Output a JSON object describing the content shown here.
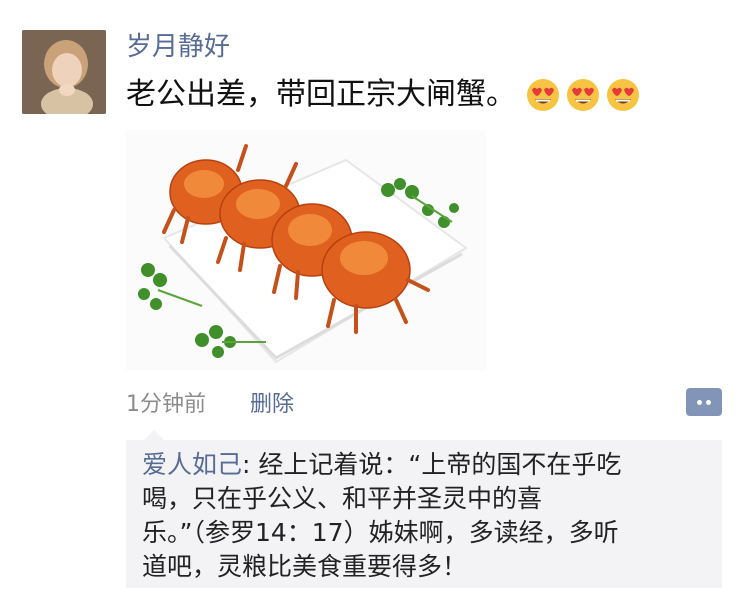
{
  "post": {
    "username": "岁月静好",
    "text": "老公出差，带回正宗大闸蟹。",
    "emojis": [
      "heart-eyes-emoji",
      "heart-eyes-emoji",
      "heart-eyes-emoji"
    ],
    "time": "1分钟前",
    "delete_label": "删除"
  },
  "comments": [
    {
      "commenter": "爱人如己",
      "separator": ": ",
      "line1": "经上记着说：“上帝的国不在乎吃",
      "line2": "喝，只在乎公义、和平并圣灵中的喜",
      "line3": "乐。”（参罗14：17）姊妹啊，多读经，多听",
      "line4": "道吧，灵粮比美食重要得多！"
    }
  ],
  "colors": {
    "link": "#576b95",
    "text": "#111111",
    "meta": "#8c8c8c",
    "comment_bg": "#f3f3f5",
    "more_button": "#8294b7"
  }
}
